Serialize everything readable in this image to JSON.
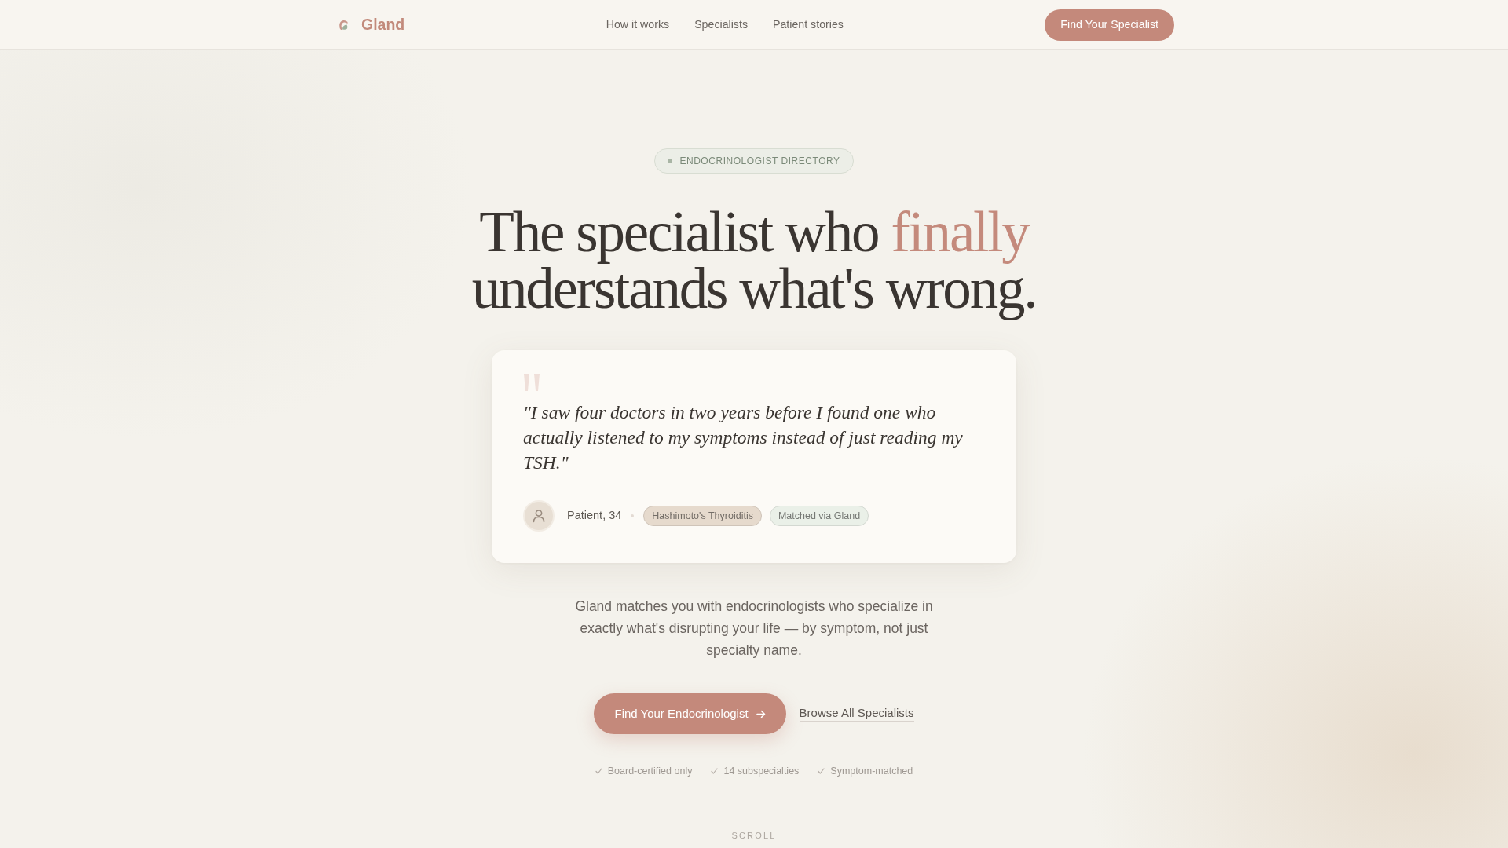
{
  "nav": {
    "brand": "Gland",
    "links": [
      {
        "label": "How it works"
      },
      {
        "label": "Specialists"
      },
      {
        "label": "Patient stories"
      }
    ],
    "cta": "Find Your Specialist"
  },
  "hero": {
    "eyebrow": "ENDOCRINOLOGIST DIRECTORY",
    "headline": [
      [
        {
          "text": "The specialist who",
          "accent": false
        },
        {
          "text": "finally",
          "accent": true
        }
      ],
      [
        {
          "text": "understands what's wrong.",
          "accent": false
        }
      ]
    ]
  },
  "testimonial": {
    "quote": "\"I saw four doctors in two years before I found one who actually listened to my symptoms instead of just reading my TSH.\"",
    "author": "Patient, 34",
    "tags": [
      {
        "label": "Hashimoto's Thyroiditis",
        "color": "#e6dacd"
      },
      {
        "label": "Matched via Gland",
        "color": "#eaf0e8"
      }
    ]
  },
  "description": "Gland matches you with endocrinologists who specialize in exactly what's disrupting your life — by symptom, not just specialty name.",
  "actions": {
    "primary": "Find Your Endocrinologist",
    "secondary": "Browse All Specialists"
  },
  "features": [
    "Board-certified only",
    "14 subspecialties",
    "Symptom-matched"
  ],
  "scroll_hint": "SCROLL"
}
